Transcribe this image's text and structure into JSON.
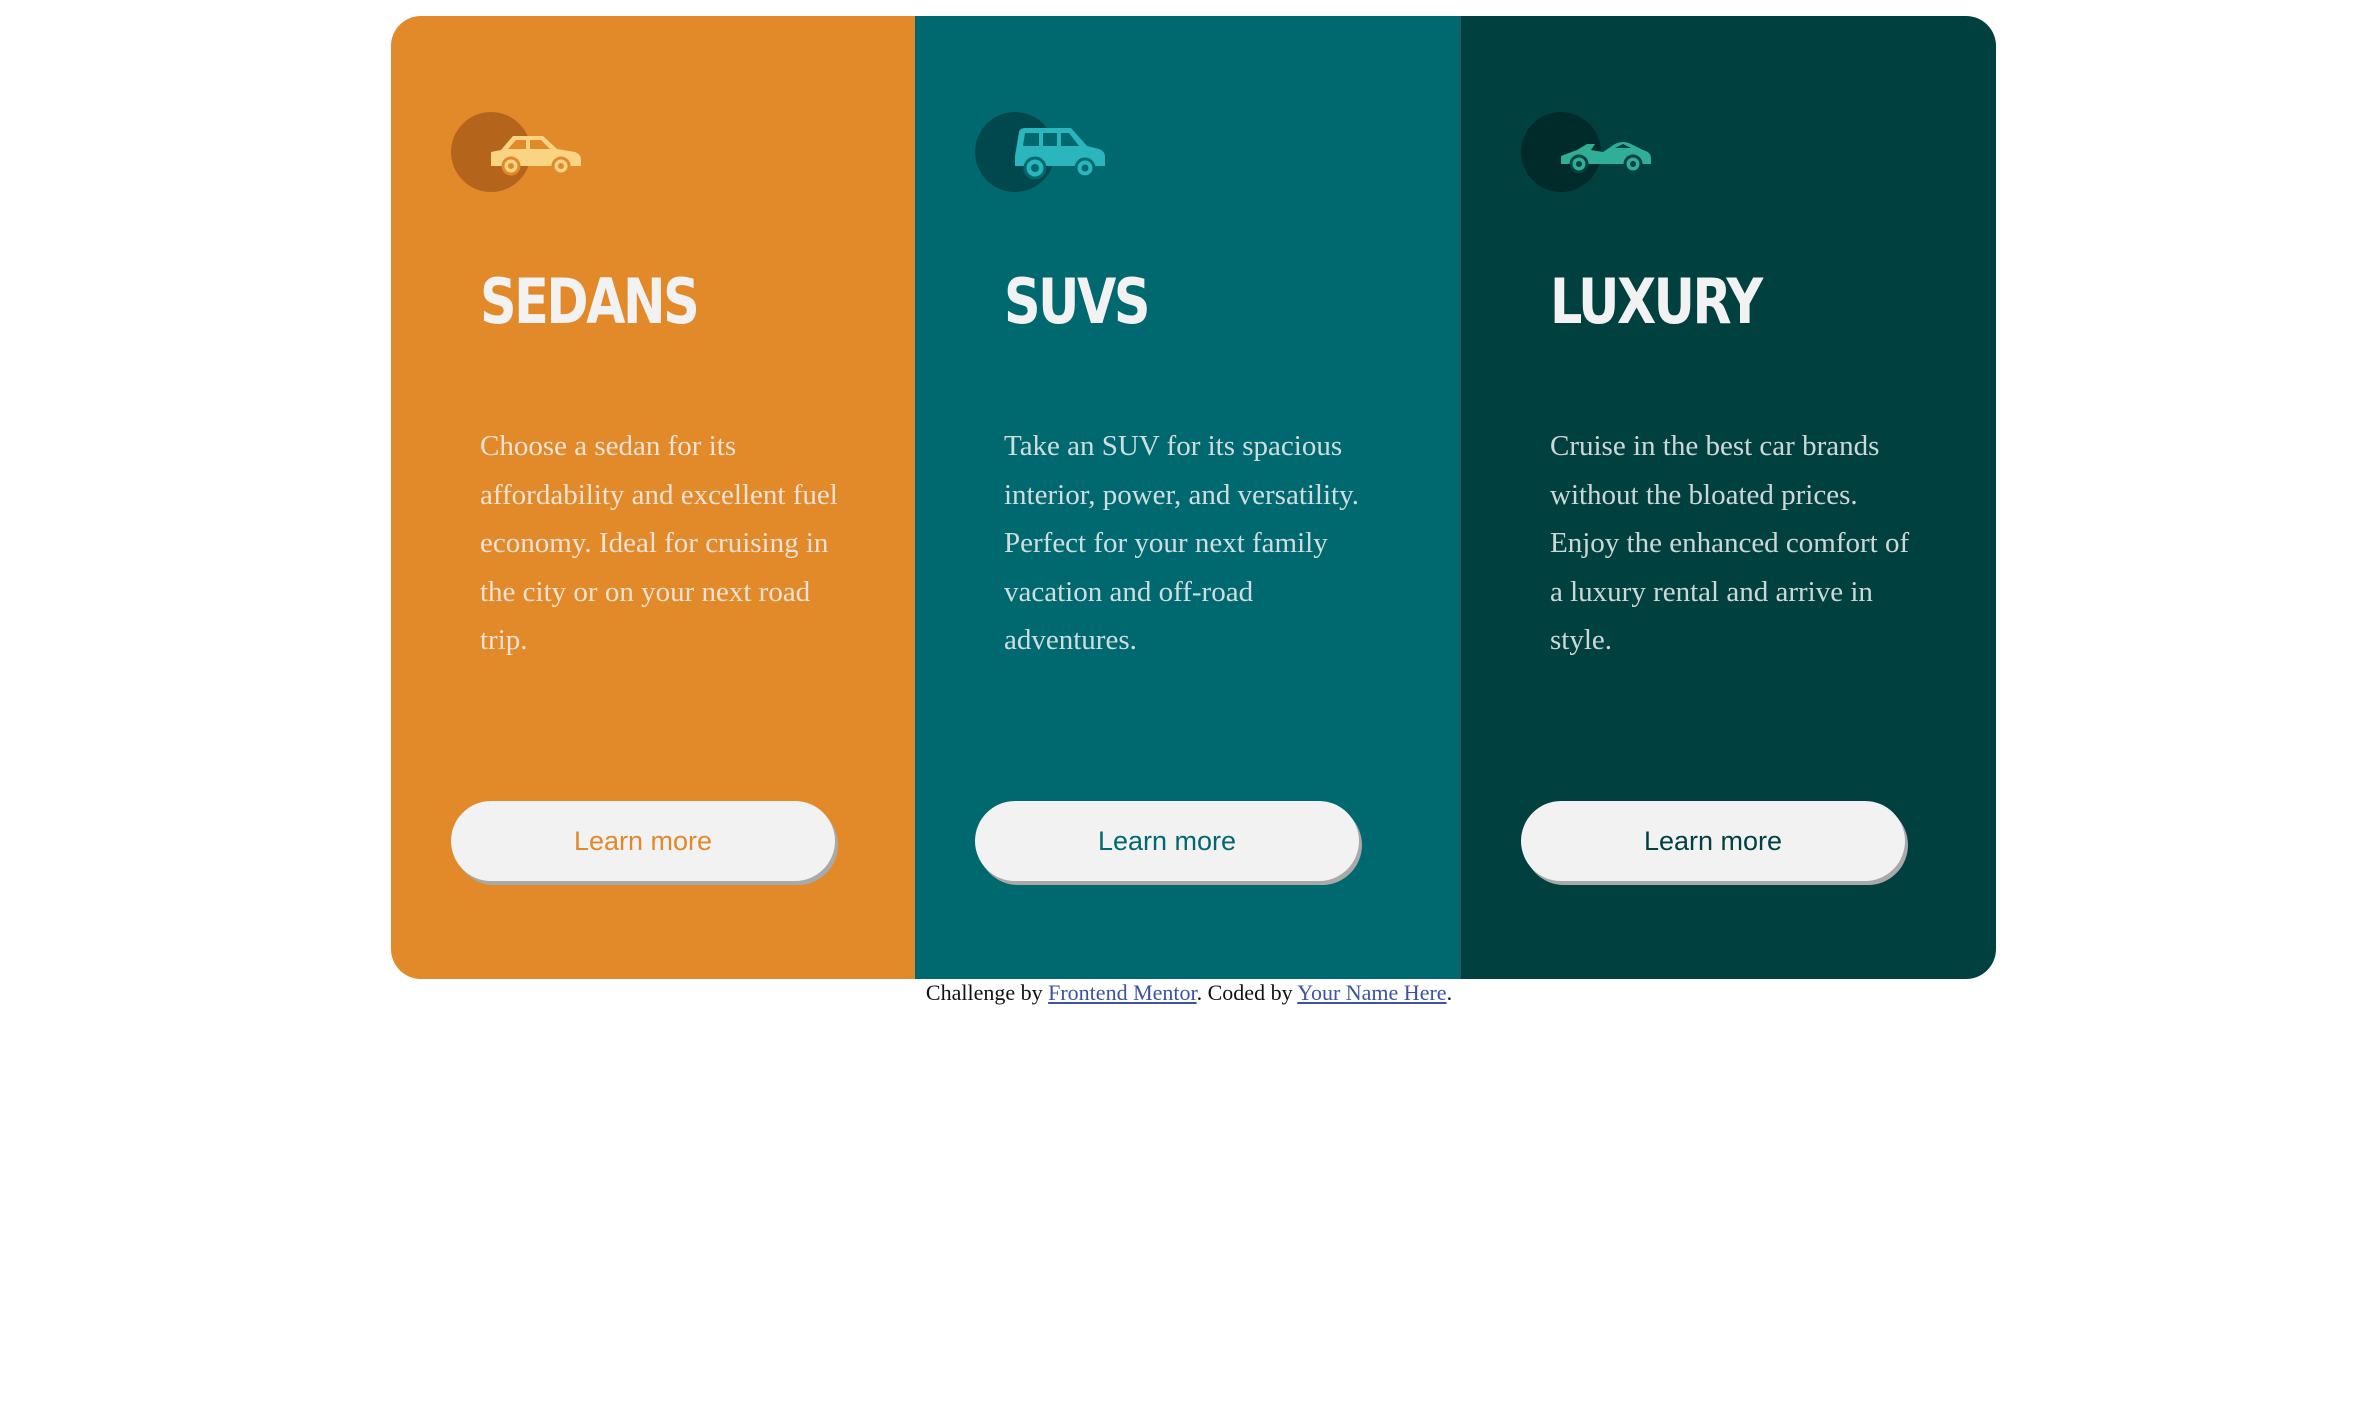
{
  "colors": {
    "sedan": "#e2892a",
    "suv": "#006970",
    "luxury": "#004140",
    "button_bg": "#f2f2f2",
    "link": "#3e52a3"
  },
  "cards": [
    {
      "id": "sedans",
      "icon": "sedan-car-icon",
      "title": "SEDANS",
      "text": "Choose a sedan for its affordability and excellent fuel economy. Ideal for cruising in the city or on your next road trip.",
      "button_label": "Learn more"
    },
    {
      "id": "suvs",
      "icon": "suv-car-icon",
      "title": "SUVS",
      "text": "Take an SUV for its spacious interior, power, and versatility. Perfect for your next family vacation and off-road adventures.",
      "button_label": "Learn more"
    },
    {
      "id": "luxury",
      "icon": "luxury-car-icon",
      "title": "LUXURY",
      "text": "Cruise in the best car brands without the bloated prices. Enjoy the enhanced comfort of a luxury rental and arrive in style.",
      "button_label": "Learn more"
    }
  ],
  "attribution": {
    "prefix": "Challenge by",
    "link1": "Frontend Mentor",
    "middle": ". Coded by",
    "link2": "Your Name Here",
    "suffix": "."
  }
}
